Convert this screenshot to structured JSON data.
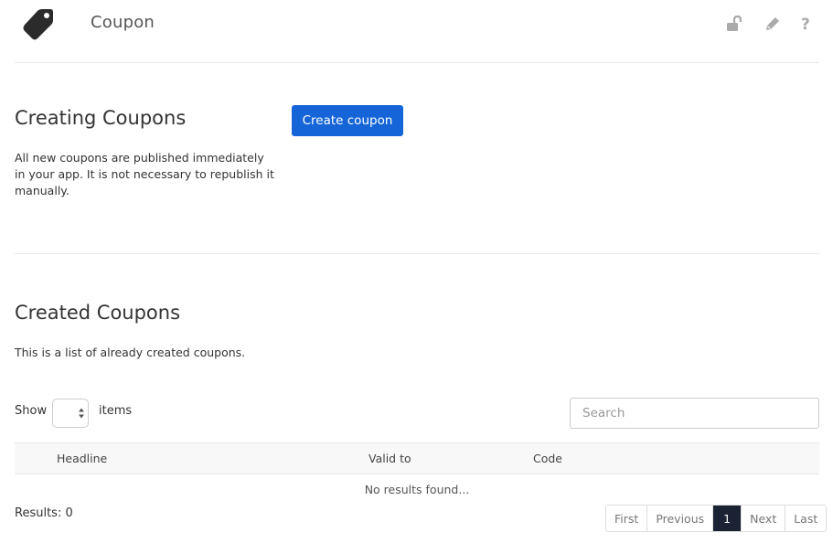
{
  "header": {
    "title": "Coupon",
    "icons": [
      "tag-icon",
      "unlock-icon",
      "pencil-icon",
      "help-icon"
    ]
  },
  "creating": {
    "heading": "Creating Coupons",
    "description_lines": [
      "All new coupons are published immediately",
      "in your app. It is not necessary to republish it",
      "manually."
    ],
    "create_button": "Create coupon"
  },
  "created": {
    "heading": "Created Coupons",
    "description": "This is a list of already created coupons.",
    "show_label": "Show",
    "items_label": "items",
    "search_placeholder": "Search",
    "columns": [
      "Headline",
      "Valid to",
      "Code"
    ],
    "empty_message": "No results found...",
    "results_label": "Results: 0",
    "pagination": {
      "first": "First",
      "previous": "Previous",
      "current": "1",
      "next": "Next",
      "last": "Last"
    }
  },
  "colors": {
    "primary": "#1565d8",
    "active_page": "#1a2233",
    "icon_gray": "#aaaaaa",
    "logo": "#2b2b2b"
  }
}
